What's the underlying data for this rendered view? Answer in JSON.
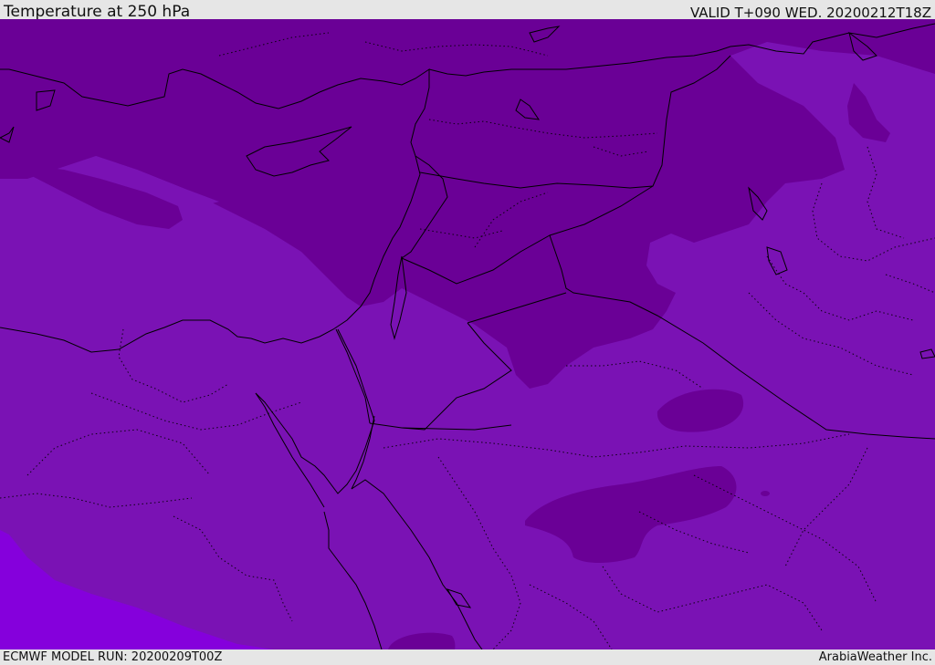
{
  "header": {
    "title": "Temperature at 250 hPa",
    "valid": "VALID T+090 WED. 20200212T18Z"
  },
  "footer": {
    "model_run": "ECMWF MODEL RUN: 20200209T00Z",
    "credit": "ArabiaWeather Inc."
  },
  "map": {
    "colors": {
      "cold_band": "#6a0096",
      "main_band": "#7a12b4",
      "warm_band": "#8500dc",
      "border": "#000000"
    },
    "icons": [
      "temperature-field",
      "coastline",
      "country-borders",
      "province-borders"
    ]
  }
}
